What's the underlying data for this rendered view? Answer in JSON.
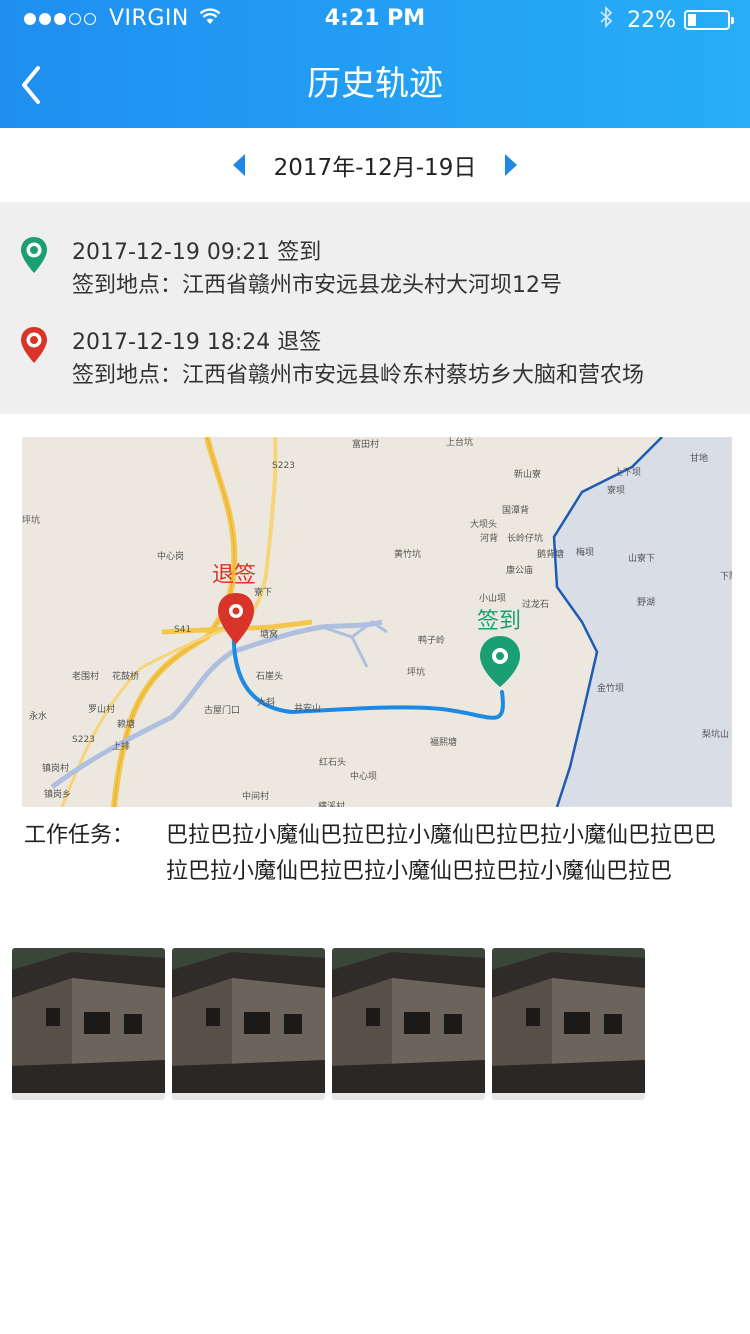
{
  "status_bar": {
    "carrier": "VIRGIN",
    "time": "4:21 PM",
    "battery_percent": "22%",
    "battery_level": 0.22,
    "signal_bars_filled": 3,
    "signal_bars_total": 5
  },
  "nav": {
    "title": "历史轨迹",
    "back_icon": "chevron-left-icon"
  },
  "date_selector": {
    "date": "2017年-12月-19日",
    "prev_icon": "triangle-left-icon",
    "next_icon": "triangle-right-icon"
  },
  "records": [
    {
      "datetime": "2017-12-19  09:21 签到",
      "location": "签到地点：江西省赣州市安远县龙头村大河坝12号",
      "pin_color": "#1a9e73"
    },
    {
      "datetime": "2017-12-19  18:24 退签",
      "location": "签到地点：江西省赣州市安远县岭东村蔡坊乡大脑和营农场",
      "pin_color": "#d8342a"
    }
  ],
  "map": {
    "checkout_label": "退签",
    "checkin_label": "签到",
    "places": [
      "富田村",
      "上台坑",
      "新山寮",
      "甘地",
      "上下坝",
      "寮坝",
      "S223",
      "坪坑",
      "国潭背",
      "大坝头",
      "河背",
      "长岭仔坑",
      "中心岗",
      "黄竹坑",
      "鹅背塘",
      "梅坝",
      "山寮下",
      "下际",
      "康公庙",
      "寮下",
      "小山坝",
      "过龙石",
      "S41",
      "鸭子岭",
      "野湖",
      "塘窝",
      "老围村",
      "花鼓桥",
      "石崖头",
      "坪坑",
      "金竹坝",
      "罗山村",
      "大斜",
      "井安山",
      "永水",
      "古屋门口",
      "福熙塘",
      "上排",
      "S223",
      "赖塘",
      "红石头",
      "梨坑山",
      "镇岗村",
      "中心坝",
      "镇岗乡",
      "中间村",
      "横溪村"
    ],
    "colors": {
      "route": "#1e88e5",
      "water": "#aebfe0",
      "road": "#f4c64e",
      "border": "#1f5bb5"
    }
  },
  "task": {
    "label": "工作任务：",
    "content": "巴拉巴拉小魔仙巴拉巴拉小魔仙巴拉巴拉小魔仙巴拉巴巴拉巴拉小魔仙巴拉巴拉小魔仙巴拉巴拉小魔仙巴拉巴"
  },
  "photos": {
    "count": 4
  }
}
